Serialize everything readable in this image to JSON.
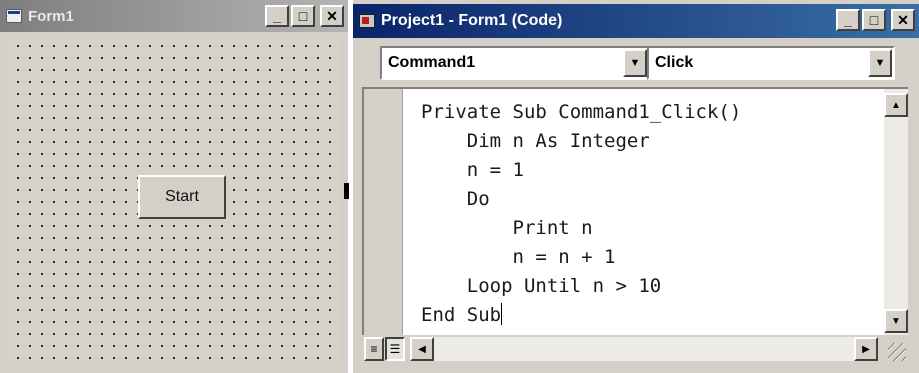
{
  "form_window": {
    "title": "Form1",
    "caption_buttons": {
      "minimize": "_",
      "maximize": "□",
      "close": "✕"
    },
    "start_button": {
      "label": "Start"
    }
  },
  "code_window": {
    "title": "Project1 - Form1 (Code)",
    "caption_buttons": {
      "minimize": "_",
      "maximize": "□",
      "close": "✕"
    },
    "object_combo": {
      "value": "Command1"
    },
    "procedure_combo": {
      "value": "Click"
    },
    "code_lines": [
      "Private Sub Command1_Click()",
      "    Dim n As Integer",
      "    n = 1",
      "    Do",
      "        Print n",
      "        n = n + 1",
      "    Loop Until n > 10",
      "End Sub"
    ]
  },
  "icons": {
    "form_icon": "form-icon",
    "code_icon": "code-window-icon",
    "dropdown": "▼",
    "scroll_up": "▲",
    "scroll_down": "▼",
    "scroll_left": "◀",
    "scroll_right": "▶"
  }
}
